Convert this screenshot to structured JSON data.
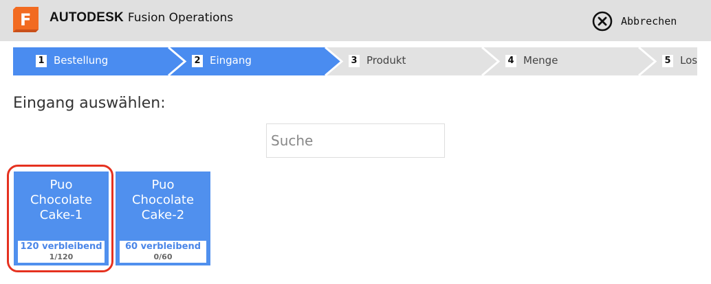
{
  "header": {
    "logo_letter": "F",
    "brand": "AUTODESK",
    "product": "Fusion Operations",
    "cancel_label": "Abbrechen",
    "logo_color": "#f26b21"
  },
  "steps": [
    {
      "num": "1",
      "label": "Bestellung",
      "state": "active"
    },
    {
      "num": "2",
      "label": "Eingang",
      "state": "active"
    },
    {
      "num": "3",
      "label": "Produkt",
      "state": "inactive"
    },
    {
      "num": "4",
      "label": "Menge",
      "state": "inactive"
    },
    {
      "num": "5",
      "label": "Los",
      "state": "inactive"
    }
  ],
  "page": {
    "title": "Eingang auswählen:",
    "search_placeholder": "Suche"
  },
  "cards": [
    {
      "name_lines": [
        "Puo",
        "Chocolate",
        "Cake-1"
      ],
      "remaining": "120 verbleibend",
      "count": "1/120",
      "highlighted": true
    },
    {
      "name_lines": [
        "Puo",
        "Chocolate",
        "Cake-2"
      ],
      "remaining": "60 verbleibend",
      "count": "0/60",
      "highlighted": false
    }
  ],
  "colors": {
    "active_step": "#4a8cf0",
    "inactive_step": "#e2e2e2",
    "card": "#5090ee",
    "highlight": "#e5311f"
  }
}
